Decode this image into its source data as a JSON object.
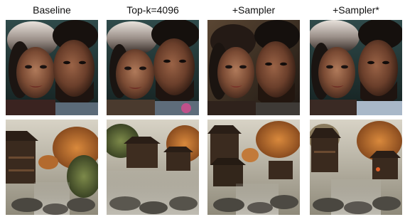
{
  "columns": [
    {
      "label": "Baseline"
    },
    {
      "label": "Top-k=4096"
    },
    {
      "label": "+Sampler"
    },
    {
      "label": "+Sampler*"
    }
  ],
  "rows": [
    {
      "subject": "portrait-of-couple"
    },
    {
      "subject": "village-by-mountain-stream"
    }
  ]
}
